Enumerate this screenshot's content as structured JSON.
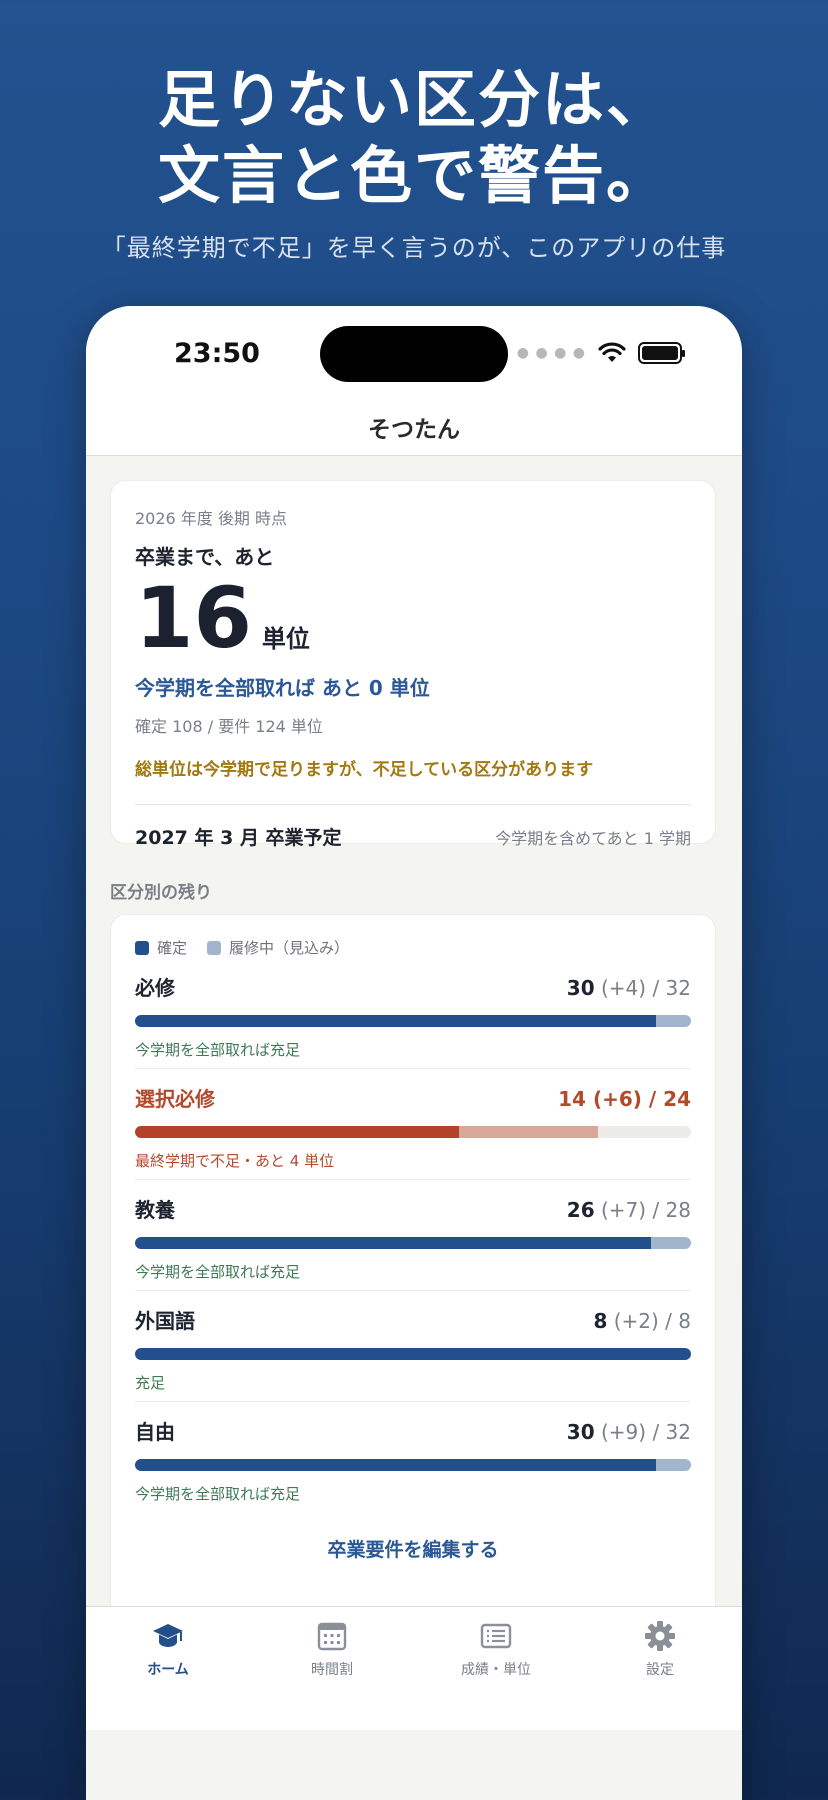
{
  "promo": {
    "headline_line1": "足りない区分は、",
    "headline_line2": "文言と色で警告。",
    "subline": "「最終学期で不足」を早く言うのが、このアプリの仕事"
  },
  "status_bar": {
    "time": "23:50"
  },
  "nav": {
    "title": "そつたん"
  },
  "summary": {
    "as_of": "2026 年度 後期 時点",
    "until_label": "卒業まで、あと",
    "remaining": "16",
    "unit": "単位",
    "if_all_text": "今学期を全部取れば あと 0 単位",
    "detail": "確定 108 / 要件 124 単位",
    "warning": "総単位は今学期で足りますが、不足している区分があります",
    "graduation": "2027 年 3 月 卒業予定",
    "graduation_note": "今学期を含めてあと 1 学期"
  },
  "section_label": "区分別の残り",
  "legend": {
    "confirmed": "確定",
    "in_progress": "履修中（見込み）"
  },
  "colors": {
    "confirmed": "#234f8c",
    "projected": "#a3b5cc",
    "warn": "#b2432a",
    "warn_projected": "#d9a797",
    "ok_text": "#3f7a55",
    "caution_text": "#a2780f"
  },
  "categories": [
    {
      "name": "必修",
      "confirmed": "30",
      "projected": "(+4)",
      "required": "/ 32",
      "confirmed_fraction": 0.9375,
      "projected_fraction": 1.0,
      "status": "今学期を全部取れば充足",
      "warn": false
    },
    {
      "name": "選択必修",
      "confirmed": "14",
      "projected": "(+6)",
      "required": "/ 24",
      "confirmed_fraction": 0.5833,
      "projected_fraction": 0.8333,
      "status": "最終学期で不足・あと 4 単位",
      "warn": true
    },
    {
      "name": "教養",
      "confirmed": "26",
      "projected": "(+7)",
      "required": "/ 28",
      "confirmed_fraction": 0.9286,
      "projected_fraction": 1.0,
      "status": "今学期を全部取れば充足",
      "warn": false
    },
    {
      "name": "外国語",
      "confirmed": "8",
      "projected": "(+2)",
      "required": "/ 8",
      "confirmed_fraction": 1.0,
      "projected_fraction": 1.0,
      "status": "充足",
      "warn": false
    },
    {
      "name": "自由",
      "confirmed": "30",
      "projected": "(+9)",
      "required": "/ 32",
      "confirmed_fraction": 0.9375,
      "projected_fraction": 1.0,
      "status": "今学期を全部取れば充足",
      "warn": false
    }
  ],
  "edit_link": "卒業要件を編集する",
  "tabs": [
    {
      "label": "ホーム",
      "icon": "graduation-cap-icon",
      "active": true
    },
    {
      "label": "時間割",
      "icon": "calendar-icon",
      "active": false
    },
    {
      "label": "成績・単位",
      "icon": "list-icon",
      "active": false
    },
    {
      "label": "設定",
      "icon": "gear-icon",
      "active": false
    }
  ]
}
